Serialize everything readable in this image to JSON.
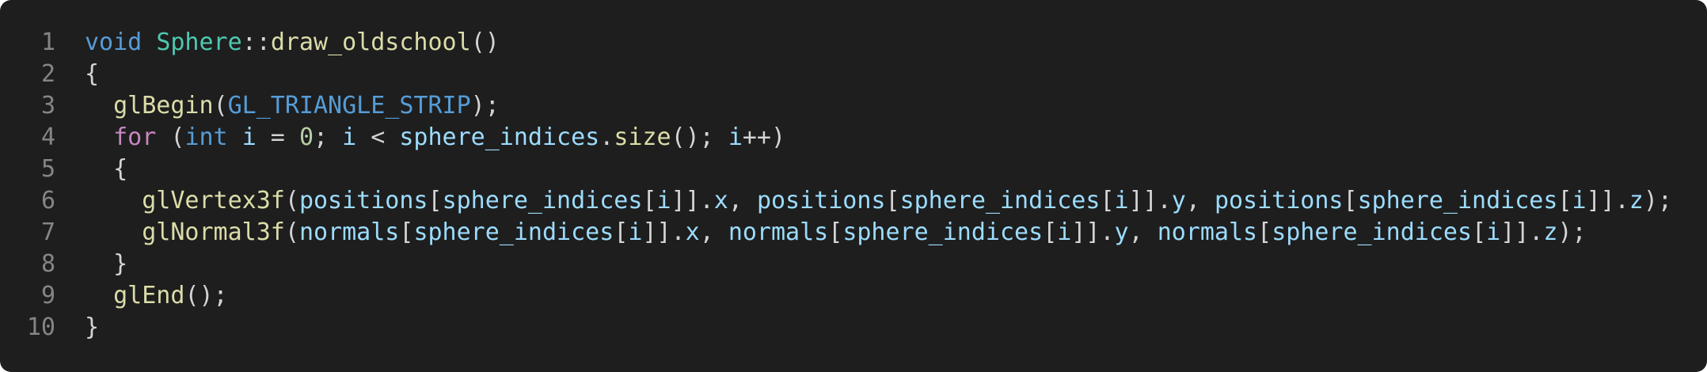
{
  "editor": {
    "language": "cpp",
    "colors": {
      "background": "#1e1e1e",
      "line_number": "#858585",
      "keyword": "#569cd6",
      "control": "#c586c0",
      "type": "#4ec9b0",
      "function": "#dcdcaa",
      "variable": "#9cdcfe",
      "number": "#b5cea8",
      "punctuation": "#d4d4d4"
    },
    "lines": [
      {
        "number": "1",
        "tokens": [
          {
            "text": "void",
            "kind": "keyword"
          },
          {
            "text": " ",
            "kind": "punctuation"
          },
          {
            "text": "Sphere",
            "kind": "type"
          },
          {
            "text": "::",
            "kind": "punctuation"
          },
          {
            "text": "draw_oldschool",
            "kind": "function"
          },
          {
            "text": "()",
            "kind": "punctuation"
          }
        ]
      },
      {
        "number": "2",
        "tokens": [
          {
            "text": "{",
            "kind": "punctuation"
          }
        ]
      },
      {
        "number": "3",
        "tokens": [
          {
            "text": "  ",
            "kind": "punctuation"
          },
          {
            "text": "glBegin",
            "kind": "function"
          },
          {
            "text": "(",
            "kind": "punctuation"
          },
          {
            "text": "GL_TRIANGLE_STRIP",
            "kind": "keyword"
          },
          {
            "text": ");",
            "kind": "punctuation"
          }
        ]
      },
      {
        "number": "4",
        "tokens": [
          {
            "text": "  ",
            "kind": "punctuation"
          },
          {
            "text": "for",
            "kind": "control"
          },
          {
            "text": " (",
            "kind": "punctuation"
          },
          {
            "text": "int",
            "kind": "keyword"
          },
          {
            "text": " ",
            "kind": "punctuation"
          },
          {
            "text": "i",
            "kind": "variable"
          },
          {
            "text": " = ",
            "kind": "punctuation"
          },
          {
            "text": "0",
            "kind": "number"
          },
          {
            "text": "; ",
            "kind": "punctuation"
          },
          {
            "text": "i",
            "kind": "variable"
          },
          {
            "text": " < ",
            "kind": "punctuation"
          },
          {
            "text": "sphere_indices",
            "kind": "variable"
          },
          {
            "text": ".",
            "kind": "punctuation"
          },
          {
            "text": "size",
            "kind": "function"
          },
          {
            "text": "(); ",
            "kind": "punctuation"
          },
          {
            "text": "i",
            "kind": "variable"
          },
          {
            "text": "++)",
            "kind": "punctuation"
          }
        ]
      },
      {
        "number": "5",
        "tokens": [
          {
            "text": "  {",
            "kind": "punctuation"
          }
        ]
      },
      {
        "number": "6",
        "tokens": [
          {
            "text": "    ",
            "kind": "punctuation"
          },
          {
            "text": "glVertex3f",
            "kind": "function"
          },
          {
            "text": "(",
            "kind": "punctuation"
          },
          {
            "text": "positions",
            "kind": "variable"
          },
          {
            "text": "[",
            "kind": "punctuation"
          },
          {
            "text": "sphere_indices",
            "kind": "variable"
          },
          {
            "text": "[",
            "kind": "punctuation"
          },
          {
            "text": "i",
            "kind": "variable"
          },
          {
            "text": "]].",
            "kind": "punctuation"
          },
          {
            "text": "x",
            "kind": "variable"
          },
          {
            "text": ", ",
            "kind": "punctuation"
          },
          {
            "text": "positions",
            "kind": "variable"
          },
          {
            "text": "[",
            "kind": "punctuation"
          },
          {
            "text": "sphere_indices",
            "kind": "variable"
          },
          {
            "text": "[",
            "kind": "punctuation"
          },
          {
            "text": "i",
            "kind": "variable"
          },
          {
            "text": "]].",
            "kind": "punctuation"
          },
          {
            "text": "y",
            "kind": "variable"
          },
          {
            "text": ", ",
            "kind": "punctuation"
          },
          {
            "text": "positions",
            "kind": "variable"
          },
          {
            "text": "[",
            "kind": "punctuation"
          },
          {
            "text": "sphere_indices",
            "kind": "variable"
          },
          {
            "text": "[",
            "kind": "punctuation"
          },
          {
            "text": "i",
            "kind": "variable"
          },
          {
            "text": "]].",
            "kind": "punctuation"
          },
          {
            "text": "z",
            "kind": "variable"
          },
          {
            "text": ");",
            "kind": "punctuation"
          }
        ]
      },
      {
        "number": "7",
        "tokens": [
          {
            "text": "    ",
            "kind": "punctuation"
          },
          {
            "text": "glNormal3f",
            "kind": "function"
          },
          {
            "text": "(",
            "kind": "punctuation"
          },
          {
            "text": "normals",
            "kind": "variable"
          },
          {
            "text": "[",
            "kind": "punctuation"
          },
          {
            "text": "sphere_indices",
            "kind": "variable"
          },
          {
            "text": "[",
            "kind": "punctuation"
          },
          {
            "text": "i",
            "kind": "variable"
          },
          {
            "text": "]].",
            "kind": "punctuation"
          },
          {
            "text": "x",
            "kind": "variable"
          },
          {
            "text": ", ",
            "kind": "punctuation"
          },
          {
            "text": "normals",
            "kind": "variable"
          },
          {
            "text": "[",
            "kind": "punctuation"
          },
          {
            "text": "sphere_indices",
            "kind": "variable"
          },
          {
            "text": "[",
            "kind": "punctuation"
          },
          {
            "text": "i",
            "kind": "variable"
          },
          {
            "text": "]].",
            "kind": "punctuation"
          },
          {
            "text": "y",
            "kind": "variable"
          },
          {
            "text": ", ",
            "kind": "punctuation"
          },
          {
            "text": "normals",
            "kind": "variable"
          },
          {
            "text": "[",
            "kind": "punctuation"
          },
          {
            "text": "sphere_indices",
            "kind": "variable"
          },
          {
            "text": "[",
            "kind": "punctuation"
          },
          {
            "text": "i",
            "kind": "variable"
          },
          {
            "text": "]].",
            "kind": "punctuation"
          },
          {
            "text": "z",
            "kind": "variable"
          },
          {
            "text": ");",
            "kind": "punctuation"
          }
        ]
      },
      {
        "number": "8",
        "tokens": [
          {
            "text": "  }",
            "kind": "punctuation"
          }
        ]
      },
      {
        "number": "9",
        "tokens": [
          {
            "text": "  ",
            "kind": "punctuation"
          },
          {
            "text": "glEnd",
            "kind": "function"
          },
          {
            "text": "();",
            "kind": "punctuation"
          }
        ]
      },
      {
        "number": "10",
        "tokens": [
          {
            "text": "}",
            "kind": "punctuation"
          }
        ]
      }
    ]
  }
}
